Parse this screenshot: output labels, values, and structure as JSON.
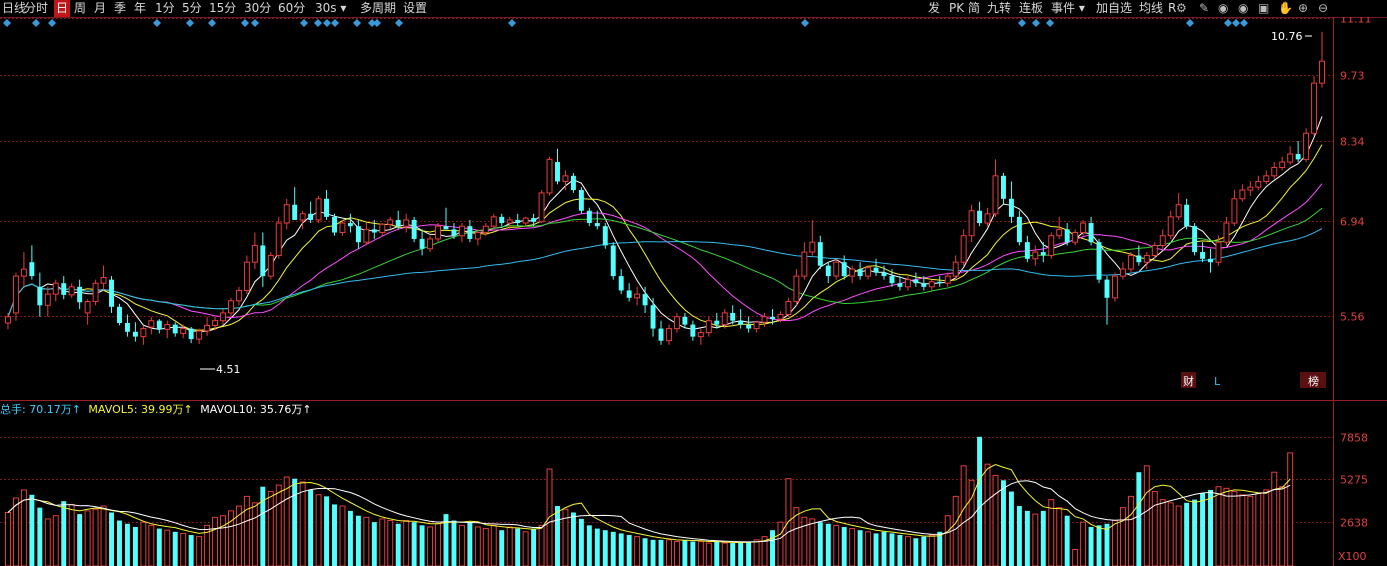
{
  "toolbar": {
    "left": [
      {
        "label": "日线",
        "active": false
      },
      {
        "label": "分时",
        "active": false
      },
      {
        "label": "日",
        "active": true
      },
      {
        "label": "周",
        "active": false
      },
      {
        "label": "月",
        "active": false
      },
      {
        "label": "季",
        "active": false
      },
      {
        "label": "年",
        "active": false
      },
      {
        "label": "1分",
        "active": false
      },
      {
        "label": "5分",
        "active": false
      },
      {
        "label": "15分",
        "active": false
      },
      {
        "label": "30分",
        "active": false
      },
      {
        "label": "60分",
        "active": false
      },
      {
        "label": "30s ▾",
        "active": false
      },
      {
        "label": "多周期",
        "active": false
      },
      {
        "label": "设置",
        "active": false
      }
    ],
    "right": [
      {
        "label": "发"
      },
      {
        "label": "PK"
      },
      {
        "label": "简"
      },
      {
        "label": "九转"
      },
      {
        "label": "连板"
      },
      {
        "label": "事件 ▾"
      },
      {
        "label": "加自选"
      },
      {
        "label": "均线"
      },
      {
        "label": "R"
      }
    ],
    "icons": [
      "settings-icon",
      "draw-icon",
      "eye-icon",
      "eye-icon",
      "image-icon",
      "hand-icon",
      "zoom-in-icon",
      "zoom-out-icon"
    ]
  },
  "colors": {
    "up": "#e83c3c",
    "down": "#54ffff",
    "ma5": "#ffffff",
    "ma10": "#f5f535",
    "ma20": "#ff4dff",
    "ma30": "#37d337",
    "ma60": "#33bbee",
    "grid": "#7a1a1a"
  },
  "price_axis": {
    "ticks": [
      "11.11",
      "9.73",
      "8.34",
      "6.94",
      "5.56"
    ]
  },
  "annotations": {
    "high": "10.76",
    "low": "4.51",
    "badge_cai": "财",
    "badge_L": "L",
    "badge_bang": "榜"
  },
  "volume": {
    "header": {
      "total": "总手: 70.17万↑",
      "mavol5": "MAVOL5: 39.99万↑",
      "mavol10": "MAVOL10: 35.76万↑"
    },
    "ticks": [
      "7858",
      "5275",
      "2638",
      "X100"
    ]
  },
  "chart_data": {
    "type": "candlestick",
    "price_ticks": [
      11.11,
      9.73,
      8.34,
      6.94,
      5.56
    ],
    "candles": [
      [
        5.47,
        5.6,
        5.39,
        5.55
      ],
      [
        5.6,
        6.15,
        5.5,
        6.1
      ],
      [
        6.1,
        6.45,
        5.95,
        6.2
      ],
      [
        6.3,
        6.55,
        6.05,
        6.1
      ],
      [
        5.95,
        6.15,
        5.55,
        5.7
      ],
      [
        5.7,
        5.95,
        5.55,
        5.85
      ],
      [
        5.85,
        6.05,
        5.75,
        6.0
      ],
      [
        6.0,
        6.1,
        5.78,
        5.84
      ],
      [
        5.84,
        6.0,
        5.8,
        5.95
      ],
      [
        5.95,
        6.05,
        5.65,
        5.74
      ],
      [
        5.6,
        5.78,
        5.45,
        5.75
      ],
      [
        5.75,
        6.05,
        5.7,
        6.0
      ],
      [
        6.0,
        6.25,
        5.9,
        6.08
      ],
      [
        6.05,
        6.1,
        5.6,
        5.68
      ],
      [
        5.68,
        5.72,
        5.44,
        5.47
      ],
      [
        5.47,
        5.58,
        5.3,
        5.36
      ],
      [
        5.36,
        5.48,
        5.24,
        5.3
      ],
      [
        5.3,
        5.44,
        5.2,
        5.4
      ],
      [
        5.42,
        5.55,
        5.33,
        5.5
      ],
      [
        5.5,
        5.52,
        5.34,
        5.39
      ],
      [
        5.39,
        5.5,
        5.28,
        5.45
      ],
      [
        5.45,
        5.48,
        5.3,
        5.34
      ],
      [
        5.34,
        5.45,
        5.28,
        5.4
      ],
      [
        5.4,
        5.42,
        5.22,
        5.27
      ],
      [
        5.27,
        5.4,
        5.21,
        5.37
      ],
      [
        5.37,
        5.55,
        5.31,
        5.44
      ],
      [
        5.44,
        5.55,
        5.38,
        5.5
      ],
      [
        5.5,
        5.65,
        5.45,
        5.6
      ],
      [
        5.6,
        5.8,
        5.55,
        5.76
      ],
      [
        5.76,
        5.95,
        5.7,
        5.9
      ],
      [
        5.9,
        6.4,
        5.85,
        6.3
      ],
      [
        6.3,
        6.75,
        6.2,
        6.55
      ],
      [
        6.55,
        6.75,
        5.95,
        6.1
      ],
      [
        6.1,
        6.45,
        6.05,
        6.4
      ],
      [
        6.4,
        7.0,
        6.35,
        6.9
      ],
      [
        6.9,
        7.3,
        6.8,
        7.2
      ],
      [
        7.2,
        7.5,
        6.95,
        6.95
      ],
      [
        6.95,
        7.1,
        6.8,
        7.05
      ],
      [
        7.05,
        7.25,
        6.9,
        6.95
      ],
      [
        6.95,
        7.35,
        6.9,
        7.3
      ],
      [
        7.3,
        7.45,
        6.95,
        7.0
      ],
      [
        7.0,
        7.05,
        6.7,
        6.75
      ],
      [
        6.75,
        6.95,
        6.7,
        6.9
      ],
      [
        6.9,
        7.05,
        6.75,
        6.85
      ],
      [
        6.85,
        6.95,
        6.5,
        6.6
      ],
      [
        6.6,
        6.9,
        6.55,
        6.8
      ],
      [
        6.8,
        6.95,
        6.65,
        6.75
      ],
      [
        6.75,
        6.9,
        6.7,
        6.88
      ],
      [
        6.88,
        7.0,
        6.8,
        6.95
      ],
      [
        6.95,
        7.1,
        6.8,
        6.85
      ],
      [
        6.85,
        7.05,
        6.75,
        6.95
      ],
      [
        6.95,
        7.0,
        6.6,
        6.65
      ],
      [
        6.65,
        6.8,
        6.4,
        6.5
      ],
      [
        6.5,
        6.7,
        6.45,
        6.65
      ],
      [
        6.65,
        6.9,
        6.6,
        6.85
      ],
      [
        6.85,
        7.15,
        6.8,
        6.8
      ],
      [
        6.8,
        6.9,
        6.65,
        6.7
      ],
      [
        6.7,
        6.9,
        6.6,
        6.85
      ],
      [
        6.85,
        6.95,
        6.6,
        6.65
      ],
      [
        6.65,
        6.8,
        6.55,
        6.75
      ],
      [
        6.75,
        6.9,
        6.7,
        6.85
      ],
      [
        6.85,
        7.05,
        6.8,
        7.0
      ],
      [
        7.0,
        7.05,
        6.85,
        6.9
      ],
      [
        6.9,
        7.0,
        6.8,
        6.95
      ],
      [
        6.95,
        7.05,
        6.85,
        6.9
      ],
      [
        6.9,
        7.0,
        6.85,
        6.98
      ],
      [
        6.98,
        7.05,
        6.85,
        6.92
      ],
      [
        6.92,
        7.45,
        6.9,
        7.4
      ],
      [
        7.4,
        8.05,
        7.35,
        8.0
      ],
      [
        7.95,
        8.2,
        7.55,
        7.6
      ],
      [
        7.6,
        7.8,
        7.45,
        7.7
      ],
      [
        7.7,
        7.75,
        7.4,
        7.45
      ],
      [
        7.45,
        7.5,
        7.05,
        7.1
      ],
      [
        7.1,
        7.15,
        6.85,
        6.9
      ],
      [
        6.9,
        7.1,
        6.8,
        6.85
      ],
      [
        6.85,
        6.9,
        6.5,
        6.55
      ],
      [
        6.55,
        6.6,
        6.05,
        6.1
      ],
      [
        6.1,
        6.2,
        5.85,
        5.9
      ],
      [
        5.9,
        6.0,
        5.75,
        5.8
      ],
      [
        5.8,
        5.95,
        5.7,
        5.85
      ],
      [
        5.85,
        5.95,
        5.6,
        5.7
      ],
      [
        5.7,
        5.8,
        5.3,
        5.4
      ],
      [
        5.4,
        5.5,
        5.2,
        5.25
      ],
      [
        5.25,
        5.45,
        5.2,
        5.4
      ],
      [
        5.4,
        5.6,
        5.35,
        5.55
      ],
      [
        5.55,
        5.6,
        5.4,
        5.45
      ],
      [
        5.45,
        5.5,
        5.25,
        5.3
      ],
      [
        5.3,
        5.4,
        5.2,
        5.35
      ],
      [
        5.35,
        5.55,
        5.3,
        5.5
      ],
      [
        5.5,
        5.6,
        5.4,
        5.45
      ],
      [
        5.45,
        5.65,
        5.4,
        5.6
      ],
      [
        5.6,
        5.7,
        5.45,
        5.5
      ],
      [
        5.5,
        5.65,
        5.4,
        5.45
      ],
      [
        5.45,
        5.55,
        5.35,
        5.4
      ],
      [
        5.4,
        5.5,
        5.35,
        5.48
      ],
      [
        5.48,
        5.6,
        5.42,
        5.55
      ],
      [
        5.55,
        5.65,
        5.45,
        5.52
      ],
      [
        5.52,
        5.62,
        5.48,
        5.58
      ],
      [
        5.58,
        5.8,
        5.55,
        5.75
      ],
      [
        5.75,
        6.2,
        5.7,
        6.1
      ],
      [
        6.1,
        6.6,
        6.05,
        6.45
      ],
      [
        6.45,
        6.95,
        6.4,
        6.6
      ],
      [
        6.6,
        6.7,
        6.2,
        6.25
      ],
      [
        6.25,
        6.3,
        6.0,
        6.1
      ],
      [
        6.1,
        6.35,
        6.05,
        6.3
      ],
      [
        6.3,
        6.4,
        6.05,
        6.1
      ],
      [
        6.1,
        6.25,
        6.0,
        6.2
      ],
      [
        6.2,
        6.3,
        6.05,
        6.1
      ],
      [
        6.1,
        6.25,
        6.05,
        6.22
      ],
      [
        6.22,
        6.35,
        6.1,
        6.15
      ],
      [
        6.15,
        6.25,
        6.05,
        6.1
      ],
      [
        6.1,
        6.2,
        5.95,
        6.0
      ],
      [
        6.0,
        6.1,
        5.9,
        5.95
      ],
      [
        5.95,
        6.1,
        5.9,
        6.05
      ],
      [
        6.05,
        6.15,
        5.95,
        6.0
      ],
      [
        6.0,
        6.1,
        5.9,
        5.95
      ],
      [
        5.95,
        6.05,
        5.9,
        6.02
      ],
      [
        6.02,
        6.1,
        5.95,
        6.0
      ],
      [
        6.0,
        6.15,
        5.95,
        6.1
      ],
      [
        6.1,
        6.4,
        6.05,
        6.3
      ],
      [
        6.3,
        6.8,
        6.25,
        6.7
      ],
      [
        6.7,
        7.2,
        6.6,
        7.1
      ],
      [
        7.1,
        7.25,
        6.85,
        6.9
      ],
      [
        6.9,
        7.15,
        6.85,
        7.05
      ],
      [
        7.05,
        8.0,
        7.0,
        7.7
      ],
      [
        7.7,
        7.75,
        7.2,
        7.3
      ],
      [
        7.3,
        7.6,
        6.9,
        7.0
      ],
      [
        7.0,
        7.1,
        6.55,
        6.6
      ],
      [
        6.6,
        6.7,
        6.3,
        6.35
      ],
      [
        6.35,
        6.55,
        6.25,
        6.45
      ],
      [
        6.45,
        6.6,
        6.3,
        6.4
      ],
      [
        6.4,
        6.75,
        6.35,
        6.7
      ],
      [
        6.7,
        7.0,
        6.65,
        6.8
      ],
      [
        6.8,
        6.9,
        6.55,
        6.6
      ],
      [
        6.6,
        6.8,
        6.55,
        6.75
      ],
      [
        6.75,
        6.95,
        6.7,
        6.9
      ],
      [
        6.9,
        7.0,
        6.55,
        6.6
      ],
      [
        6.6,
        6.65,
        6.0,
        6.05
      ],
      [
        6.05,
        6.1,
        5.45,
        5.8
      ],
      [
        5.8,
        6.15,
        5.75,
        6.1
      ],
      [
        6.1,
        6.3,
        6.05,
        6.2
      ],
      [
        6.2,
        6.45,
        6.15,
        6.4
      ],
      [
        6.4,
        6.55,
        6.25,
        6.3
      ],
      [
        6.3,
        6.45,
        6.2,
        6.4
      ],
      [
        6.4,
        6.6,
        6.35,
        6.55
      ],
      [
        6.55,
        6.8,
        6.5,
        6.7
      ],
      [
        6.7,
        7.1,
        6.65,
        7.0
      ],
      [
        7.0,
        7.4,
        6.95,
        7.2
      ],
      [
        7.2,
        7.3,
        6.8,
        6.85
      ],
      [
        6.85,
        6.9,
        6.4,
        6.45
      ],
      [
        6.45,
        6.6,
        6.3,
        6.35
      ],
      [
        6.35,
        6.5,
        6.15,
        6.3
      ],
      [
        6.3,
        6.7,
        6.25,
        6.6
      ],
      [
        6.6,
        7.0,
        6.55,
        6.9
      ],
      [
        6.9,
        7.45,
        6.85,
        7.3
      ],
      [
        7.3,
        7.55,
        7.25,
        7.45
      ],
      [
        7.45,
        7.6,
        7.35,
        7.5
      ],
      [
        7.5,
        7.7,
        7.45,
        7.6
      ],
      [
        7.6,
        7.8,
        7.55,
        7.7
      ],
      [
        7.7,
        7.95,
        7.65,
        7.85
      ],
      [
        7.85,
        8.05,
        7.8,
        7.95
      ],
      [
        7.95,
        8.25,
        7.9,
        8.1
      ],
      [
        8.1,
        8.35,
        7.95,
        8.0
      ],
      [
        8.0,
        8.6,
        7.95,
        8.5
      ],
      [
        8.5,
        9.7,
        8.45,
        9.55
      ],
      [
        9.55,
        10.76,
        9.45,
        10.05
      ]
    ],
    "ma": {
      "ma5_color": "#ffffff",
      "ma10_color": "#f5f535",
      "ma20_color": "#ff4dff",
      "ma30_color": "#37d337",
      "ma60_color": "#33bbee"
    },
    "volume_ticks": [
      7858,
      5275,
      2638
    ],
    "volume": [
      3200,
      4100,
      4600,
      4300,
      3500,
      2800,
      3000,
      3900,
      3700,
      3100,
      3300,
      3400,
      3600,
      3200,
      2700,
      2500,
      2300,
      2600,
      2400,
      2200,
      2100,
      2000,
      1900,
      1800,
      1700,
      2400,
      2900,
      3000,
      3300,
      3600,
      4200,
      3800,
      4800,
      4500,
      4900,
      5400,
      5300,
      5100,
      4600,
      4300,
      4200,
      3700,
      3600,
      3300,
      3000,
      2900,
      2600,
      2800,
      2700,
      2500,
      2700,
      2600,
      2400,
      2300,
      2500,
      3100,
      2700,
      2400,
      2600,
      2300,
      2200,
      2400,
      2100,
      2300,
      2200,
      2000,
      2200,
      2400,
      5900,
      3600,
      3400,
      3200,
      2800,
      2400,
      2200,
      2100,
      2000,
      1900,
      1800,
      1700,
      1600,
      1500,
      1500,
      1500,
      1400,
      1500,
      1400,
      1400,
      1300,
      1400,
      1300,
      1300,
      1350,
      1400,
      1500,
      1700,
      2100,
      2600,
      5300,
      3500,
      2900,
      2800,
      2600,
      2500,
      2400,
      2300,
      2200,
      2100,
      2000,
      1900,
      2000,
      1900,
      1800,
      1700,
      1600,
      1700,
      1800,
      2000,
      3000,
      4200,
      6100,
      5200,
      7900,
      6200,
      5500,
      5200,
      4500,
      3600,
      3300,
      3100,
      3300,
      4000,
      3500,
      3000,
      900,
      2600,
      2300,
      2400,
      2500,
      2700,
      3500,
      4200,
      5700,
      6100,
      4500,
      4000,
      3800,
      3600,
      3800,
      4000,
      4400,
      4600,
      4800,
      4700,
      4500,
      4300,
      4200,
      4400,
      4600,
      5700,
      4800,
      6900
    ]
  }
}
